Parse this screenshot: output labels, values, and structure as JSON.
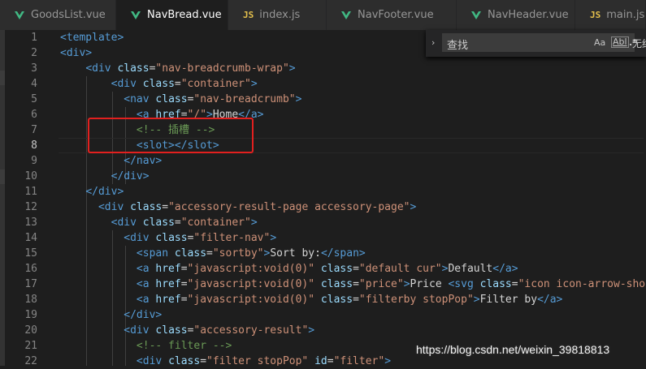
{
  "tabs": [
    {
      "label": "GoodsList.vue",
      "icon": "vue-icon",
      "active": false
    },
    {
      "label": "NavBread.vue",
      "icon": "vue-icon",
      "active": true
    },
    {
      "label": "index.js",
      "icon": "js-icon",
      "active": false
    },
    {
      "label": "NavFooter.vue",
      "icon": "vue-icon",
      "active": false
    },
    {
      "label": "NavHeader.vue",
      "icon": "vue-icon",
      "active": false
    },
    {
      "label": "main.js",
      "icon": "js-icon",
      "active": false
    }
  ],
  "js_badge": "JS",
  "find_widget": {
    "expand_glyph": "›",
    "placeholder": "查找",
    "match_case": "Aa",
    "whole_word": "Abl",
    "regex": ".*",
    "result": "无结"
  },
  "current_line": 8,
  "line_numbers": [
    "1",
    "2",
    "3",
    "4",
    "5",
    "6",
    "7",
    "8",
    "9",
    "10",
    "11",
    "12",
    "13",
    "14",
    "15",
    "16",
    "17",
    "18",
    "19",
    "20",
    "21",
    "22"
  ],
  "code_lines": [
    [
      [
        "tag",
        "<template>"
      ]
    ],
    [
      [
        "tag",
        "<div>"
      ]
    ],
    [
      [
        "txt",
        "    "
      ],
      [
        "tag",
        "<div "
      ],
      [
        "attr",
        "class"
      ],
      [
        "txt",
        "="
      ],
      [
        "str",
        "\"nav-breadcrumb-wrap\""
      ],
      [
        "tag",
        ">"
      ]
    ],
    [
      [
        "txt",
        "        "
      ],
      [
        "tag",
        "<div "
      ],
      [
        "attr",
        "class"
      ],
      [
        "txt",
        "="
      ],
      [
        "str",
        "\"container\""
      ],
      [
        "tag",
        ">"
      ]
    ],
    [
      [
        "txt",
        "          "
      ],
      [
        "tag",
        "<nav "
      ],
      [
        "attr",
        "class"
      ],
      [
        "txt",
        "="
      ],
      [
        "str",
        "\"nav-breadcrumb\""
      ],
      [
        "tag",
        ">"
      ]
    ],
    [
      [
        "txt",
        "            "
      ],
      [
        "tag",
        "<a "
      ],
      [
        "attr",
        "href"
      ],
      [
        "txt",
        "="
      ],
      [
        "str",
        "\"/\""
      ],
      [
        "tag",
        ">"
      ],
      [
        "txt",
        "Home"
      ],
      [
        "tag",
        "</a>"
      ]
    ],
    [
      [
        "txt",
        "            "
      ],
      [
        "cmt",
        "<!-- 插槽 -->"
      ]
    ],
    [
      [
        "txt",
        "            "
      ],
      [
        "tag",
        "<slot>"
      ],
      [
        "tag",
        "</slot>"
      ]
    ],
    [
      [
        "txt",
        "          "
      ],
      [
        "tag",
        "</nav>"
      ]
    ],
    [
      [
        "txt",
        "        "
      ],
      [
        "tag",
        "</div>"
      ]
    ],
    [
      [
        "txt",
        "    "
      ],
      [
        "tag",
        "</div>"
      ]
    ],
    [
      [
        "txt",
        "      "
      ],
      [
        "tag",
        "<div "
      ],
      [
        "attr",
        "class"
      ],
      [
        "txt",
        "="
      ],
      [
        "str",
        "\"accessory-result-page accessory-page\""
      ],
      [
        "tag",
        ">"
      ]
    ],
    [
      [
        "txt",
        "        "
      ],
      [
        "tag",
        "<div "
      ],
      [
        "attr",
        "class"
      ],
      [
        "txt",
        "="
      ],
      [
        "str",
        "\"container\""
      ],
      [
        "tag",
        ">"
      ]
    ],
    [
      [
        "txt",
        "          "
      ],
      [
        "tag",
        "<div "
      ],
      [
        "attr",
        "class"
      ],
      [
        "txt",
        "="
      ],
      [
        "str",
        "\"filter-nav\""
      ],
      [
        "tag",
        ">"
      ]
    ],
    [
      [
        "txt",
        "            "
      ],
      [
        "tag",
        "<span "
      ],
      [
        "attr",
        "class"
      ],
      [
        "txt",
        "="
      ],
      [
        "str",
        "\"sortby\""
      ],
      [
        "tag",
        ">"
      ],
      [
        "txt",
        "Sort by:"
      ],
      [
        "tag",
        "</span>"
      ]
    ],
    [
      [
        "txt",
        "            "
      ],
      [
        "tag",
        "<a "
      ],
      [
        "attr",
        "href"
      ],
      [
        "txt",
        "="
      ],
      [
        "str",
        "\"javascript:void(0)\""
      ],
      [
        "txt",
        " "
      ],
      [
        "attr",
        "class"
      ],
      [
        "txt",
        "="
      ],
      [
        "str",
        "\"default cur\""
      ],
      [
        "tag",
        ">"
      ],
      [
        "txt",
        "Default"
      ],
      [
        "tag",
        "</a>"
      ]
    ],
    [
      [
        "txt",
        "            "
      ],
      [
        "tag",
        "<a "
      ],
      [
        "attr",
        "href"
      ],
      [
        "txt",
        "="
      ],
      [
        "str",
        "\"javascript:void(0)\""
      ],
      [
        "txt",
        " "
      ],
      [
        "attr",
        "class"
      ],
      [
        "txt",
        "="
      ],
      [
        "str",
        "\"price\""
      ],
      [
        "tag",
        ">"
      ],
      [
        "txt",
        "Price "
      ],
      [
        "tag",
        "<svg "
      ],
      [
        "attr",
        "class"
      ],
      [
        "txt",
        "="
      ],
      [
        "str",
        "\"icon icon-arrow-short"
      ]
    ],
    [
      [
        "txt",
        "            "
      ],
      [
        "tag",
        "<a "
      ],
      [
        "attr",
        "href"
      ],
      [
        "txt",
        "="
      ],
      [
        "str",
        "\"javascript:void(0)\""
      ],
      [
        "txt",
        " "
      ],
      [
        "attr",
        "class"
      ],
      [
        "txt",
        "="
      ],
      [
        "str",
        "\"filterby stopPop\""
      ],
      [
        "tag",
        ">"
      ],
      [
        "txt",
        "Filter by"
      ],
      [
        "tag",
        "</a>"
      ]
    ],
    [
      [
        "txt",
        "          "
      ],
      [
        "tag",
        "</div>"
      ]
    ],
    [
      [
        "txt",
        "          "
      ],
      [
        "tag",
        "<div "
      ],
      [
        "attr",
        "class"
      ],
      [
        "txt",
        "="
      ],
      [
        "str",
        "\"accessory-result\""
      ],
      [
        "tag",
        ">"
      ]
    ],
    [
      [
        "txt",
        "            "
      ],
      [
        "cmt",
        "<!-- filter -->"
      ]
    ],
    [
      [
        "txt",
        "            "
      ],
      [
        "tag",
        "<div "
      ],
      [
        "attr",
        "class"
      ],
      [
        "txt",
        "="
      ],
      [
        "str",
        "\"filter stopPop\""
      ],
      [
        "txt",
        " "
      ],
      [
        "attr",
        "id"
      ],
      [
        "txt",
        "="
      ],
      [
        "str",
        "\"filter\""
      ],
      [
        "tag",
        ">"
      ]
    ]
  ],
  "watermark": "https://blog.csdn.net/weixin_39818813"
}
